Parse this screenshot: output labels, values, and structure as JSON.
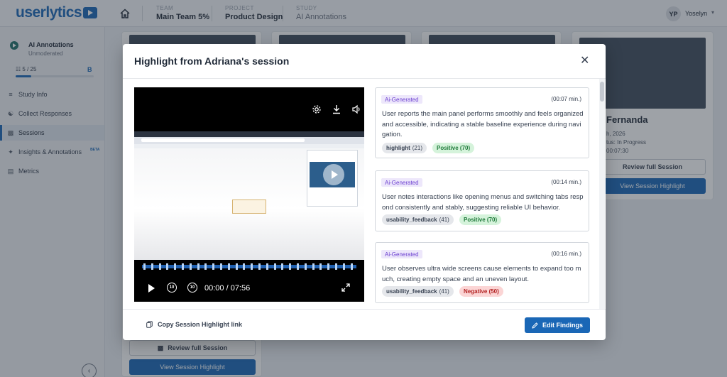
{
  "header": {
    "logo": "userlytics",
    "crumbs": [
      {
        "label": "TEAM",
        "value": "Main Team 5%"
      },
      {
        "label": "PROJECT",
        "value": "Product Design"
      },
      {
        "label": "STUDY",
        "value": "AI Annotations"
      }
    ],
    "user_initials": "YP",
    "user_name": "Yoselyn"
  },
  "sidebar": {
    "study_name": "AI Annotations",
    "study_type": "Unmoderated",
    "progress_text": "5 / 25",
    "progress_fraction": 0.2,
    "progress_badge": "B",
    "items": [
      {
        "label": "Study Info",
        "icon": "list-icon"
      },
      {
        "label": "Collect Responses",
        "icon": "users-icon"
      },
      {
        "label": "Sessions",
        "icon": "video-icon"
      },
      {
        "label": "Insights & Annotations",
        "icon": "sparkle-icon",
        "badge": "BETA"
      },
      {
        "label": "Metrics",
        "icon": "chart-icon"
      }
    ]
  },
  "background": {
    "right_card": {
      "name": "Fernanda",
      "date": "h, 2026",
      "status": "tus: In Progress",
      "duration": "00:07:30",
      "review_label": "Review full Session",
      "highlight_label": "View Session Highlight"
    },
    "left_card": {
      "review_label": "Review full Session",
      "highlight_label": "View Session Highlight"
    }
  },
  "modal": {
    "title": "Highlight from Adriana's session",
    "video": {
      "time": "00:00 / 07:56",
      "skip_back": "10",
      "skip_forward": "10"
    },
    "findings": [
      {
        "badge": "Ai-Generated",
        "time": "(00:07 min.)",
        "text": "User reports the main panel performs smoothly and feels organized and accessible, indicating a stable baseline experience during navigation.",
        "tags": [
          {
            "label": "highlight",
            "count": "(21)",
            "kind": "gray"
          },
          {
            "label": "Positive (70)",
            "kind": "pos"
          }
        ]
      },
      {
        "badge": "Ai-Generated",
        "time": "(00:14 min.)",
        "text": "User notes interactions like opening menus and switching tabs respond consistently and stably, suggesting reliable UI behavior.",
        "tags": [
          {
            "label": "usability_feedback",
            "count": "(41)",
            "kind": "gray"
          },
          {
            "label": "Positive (70)",
            "kind": "pos"
          }
        ]
      },
      {
        "badge": "Ai-Generated",
        "time": "(00:16 min.)",
        "text": "User observes ultra wide screens cause elements to expand too much, creating empty space and an uneven layout.",
        "tags": [
          {
            "label": "usability_feedback",
            "count": "(41)",
            "kind": "gray"
          },
          {
            "label": "Negative (50)",
            "kind": "neg"
          }
        ]
      }
    ],
    "footer": {
      "copy_label": "Copy Session Highlight link",
      "edit_label": "Edit Findings"
    }
  },
  "colors": {
    "brand": "#1a67b6",
    "positive": "#1f7a3a",
    "negative": "#b42323",
    "ai_badge": "#6b3fd0"
  }
}
